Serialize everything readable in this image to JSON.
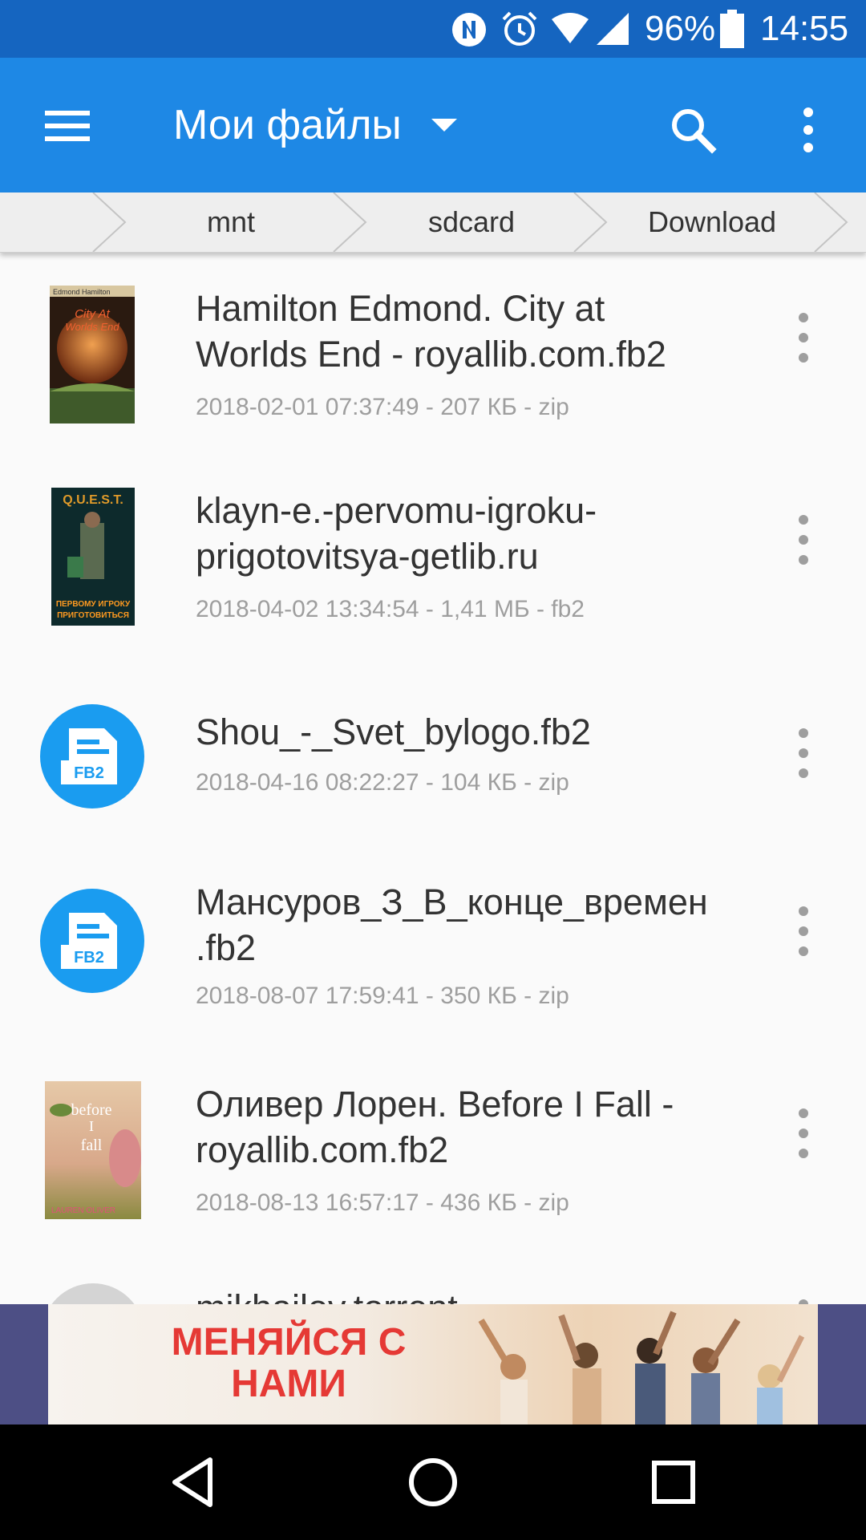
{
  "status_bar": {
    "icons": [
      "nfc-icon",
      "alarm-icon",
      "wifi-icon",
      "signal-icon",
      "battery-icon"
    ],
    "battery": "96%",
    "time": "14:55"
  },
  "app_bar": {
    "title": "Мои файлы",
    "icons": [
      "menu-icon",
      "dropdown-caret-icon",
      "search-icon",
      "more-vert-icon"
    ],
    "colors": {
      "status_bar": "#1565c0",
      "app_bar": "#1e88e5"
    }
  },
  "breadcrumb": [
    "mnt",
    "sdcard",
    "Download"
  ],
  "files": [
    {
      "name_line1": "Hamilton Edmond. City at",
      "name_line2": "Worlds End - royallib.com.fb2",
      "meta": "2018-02-01 07:37:49 - 207 КБ - zip",
      "thumbnail": "book-cover",
      "cover_text": [
        "Edmond Hamilton",
        "City At",
        "Worlds End"
      ]
    },
    {
      "name_line1": "klayn-e.-pervomu-igroku-",
      "name_line2": "prigotovitsya-getlib.ru",
      "meta": "2018-04-02 13:34:54 - 1,41 МБ - fb2",
      "thumbnail": "book-cover",
      "cover_text": [
        "Q.U.E.S.T.",
        "ПЕРВОМУ ИГРОКУ",
        "ПРИГОТОВИТЬСЯ"
      ]
    },
    {
      "name_line1": "Shou_-_Svet_bylogo.fb2",
      "name_line2": "",
      "meta": "2018-04-16 08:22:27 - 104 КБ - zip",
      "thumbnail": "fb2-file-icon",
      "badge": "FB2"
    },
    {
      "name_line1": "Мансуров_З_В_конце_времен",
      "name_line2": ".fb2",
      "meta": "2018-08-07 17:59:41 - 350 КБ - zip",
      "thumbnail": "fb2-file-icon",
      "badge": "FB2"
    },
    {
      "name_line1": "Оливер Лорен. Before I Fall -",
      "name_line2": "royallib.com.fb2",
      "meta": "2018-08-13 16:57:17 - 436 КБ - zip",
      "thumbnail": "book-cover",
      "cover_text": [
        "before",
        "I",
        "fall",
        "LAUREN OLIVER"
      ]
    },
    {
      "name_line1": "mikhailov.torrent",
      "name_line2": "",
      "meta": "",
      "thumbnail": "file-icon"
    }
  ],
  "ad_banner": {
    "text_line1": "МЕНЯЙСЯ С",
    "text_line2": "НАМИ"
  },
  "nav_bar": {
    "icons": [
      "back-icon",
      "home-icon",
      "recents-icon"
    ]
  }
}
